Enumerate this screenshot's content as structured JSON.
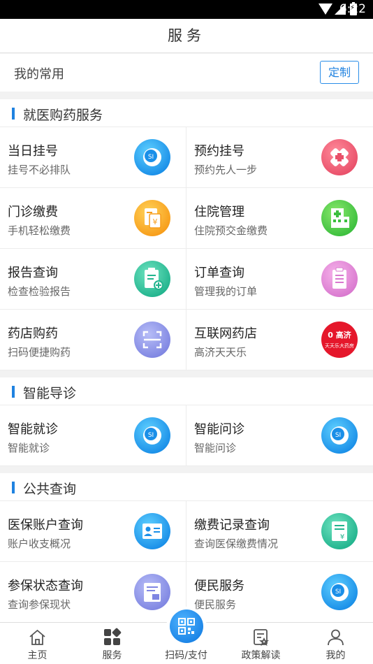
{
  "status_bar": {
    "time": "6:22"
  },
  "header": {
    "title": "服务"
  },
  "favorites": {
    "label": "我的常用",
    "customize_button": "定制"
  },
  "sections": [
    {
      "title": "就医购药服务",
      "items": [
        {
          "title": "当日挂号",
          "subtitle": "挂号不必排队",
          "icon": "social-security-icon",
          "color": "#1a8fe8"
        },
        {
          "title": "预约挂号",
          "subtitle": "预约先人一步",
          "icon": "hospital-cross-icon",
          "color": "#e9506a"
        },
        {
          "title": "门诊缴费",
          "subtitle": "手机轻松缴费",
          "icon": "bill-yen-icon",
          "color": "#f79d1a"
        },
        {
          "title": "住院管理",
          "subtitle": "住院预交金缴费",
          "icon": "inpatient-building-icon",
          "color": "#3cbf3e"
        },
        {
          "title": "报告查询",
          "subtitle": "检查检验报告",
          "icon": "report-clipboard-icon",
          "color": "#22b48e"
        },
        {
          "title": "订单查询",
          "subtitle": "管理我的订单",
          "icon": "order-clipboard-icon",
          "color": "#d979cf"
        },
        {
          "title": "药店购药",
          "subtitle": "扫码便捷购药",
          "icon": "scan-frame-icon",
          "color": "#7f86e2"
        },
        {
          "title": "互联网药店",
          "subtitle": "高济天天乐",
          "icon": "pharmacy-logo-icon",
          "color": "#e5172b",
          "logo_top": "0 高济",
          "logo_bottom": "天天乐大药房"
        }
      ]
    },
    {
      "title": "智能导诊",
      "items": [
        {
          "title": "智能就诊",
          "subtitle": "智能就诊",
          "icon": "social-security-icon",
          "color": "#1a8fe8"
        },
        {
          "title": "智能问诊",
          "subtitle": "智能问诊",
          "icon": "social-security-icon",
          "color": "#1a8fe8"
        }
      ]
    },
    {
      "title": "公共查询",
      "items": [
        {
          "title": "医保账户查询",
          "subtitle": "账户收支概况",
          "icon": "id-card-icon",
          "color": "#1a8fe8"
        },
        {
          "title": "缴费记录查询",
          "subtitle": "查询医保缴费情况",
          "icon": "payment-record-icon",
          "color": "#22b48e"
        },
        {
          "title": "参保状态查询",
          "subtitle": "查询参保现状",
          "icon": "insurance-doc-icon",
          "color": "#7f86e2"
        },
        {
          "title": "便民服务",
          "subtitle": "便民服务",
          "icon": "social-security-icon",
          "color": "#1a8fe8"
        }
      ]
    }
  ],
  "tab_bar": {
    "tabs": [
      {
        "label": "主页",
        "icon": "home-icon"
      },
      {
        "label": "服务",
        "icon": "grid-apps-icon",
        "active": true
      },
      {
        "label": "扫码/支付",
        "icon": "qr-code-icon"
      },
      {
        "label": "政策解读",
        "icon": "policy-doc-icon"
      },
      {
        "label": "我的",
        "icon": "user-icon"
      }
    ]
  }
}
